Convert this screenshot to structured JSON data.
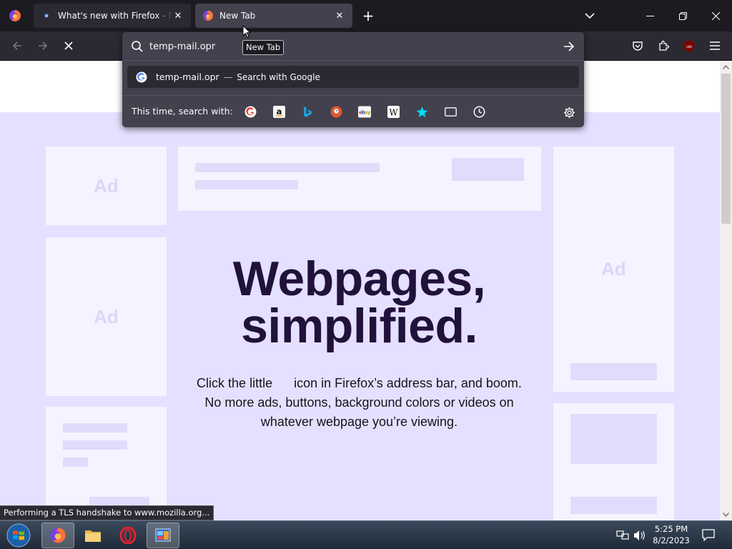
{
  "browser": {
    "firefox_button_icon": "firefox-logo",
    "tabs": [
      {
        "label": "What's new with Firefox - More",
        "favicon": "firefox-dot-icon",
        "close": "✕"
      },
      {
        "label": "New Tab",
        "favicon": "firefox-logo",
        "close": "✕"
      }
    ],
    "new_tab_symbol": "+",
    "window_controls": {
      "minimize": "–",
      "maximize": "❐",
      "close": "✕"
    }
  },
  "navbar": {
    "icons": [
      "back-arrow-icon",
      "forward-arrow-icon",
      "stop-icon",
      "pocket-icon",
      "extensions-icon",
      "ublock-icon",
      "hamburger-menu-icon"
    ],
    "ublock_label": "uo"
  },
  "urlbar": {
    "value": "temp-mail.opr",
    "tooltip": "New Tab",
    "suggestion": {
      "text": "temp-mail.opr",
      "separator": "—",
      "action": "Search with Google"
    },
    "oneoff_label": "This time, search with:",
    "engines": [
      "google",
      "amazon",
      "bing",
      "duckduckgo",
      "ebay",
      "wikipedia",
      "bookmarks",
      "tabs",
      "history"
    ]
  },
  "page": {
    "ad_label": "Ad",
    "hero_title_line1": "Webpages,",
    "hero_title_line2": "simplified.",
    "hero_text_line1": "Click the little      icon in Firefox’s address bar, and boom.",
    "hero_text_line2": "No more ads, buttons, background colors or videos on",
    "hero_text_line3": "whatever webpage you’re viewing."
  },
  "status_text": "Performing a TLS handshake to www.mozilla.org...",
  "taskbar": {
    "apps": [
      "firefox",
      "file-explorer",
      "opera",
      "control-panel"
    ],
    "time": "5:25 PM",
    "date": "8/2/2023"
  },
  "colors": {
    "chrome_dark": "#1c1b22",
    "toolbar": "#2b2a33",
    "urlbar": "#42414d",
    "page_bg": "#e5e0ff",
    "hero_title": "#20123a"
  }
}
